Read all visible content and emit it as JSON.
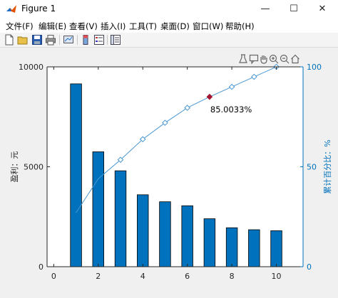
{
  "window": {
    "title": "Figure 1",
    "minimize_glyph": "—",
    "maximize_glyph": "☐",
    "close_glyph": "✕"
  },
  "menu": {
    "items": [
      "文件(F)",
      "编辑(E)",
      "查看(V)",
      "插入(I)",
      "工具(T)",
      "桌面(D)",
      "窗口(W)",
      "帮助(H)"
    ]
  },
  "toolbar": {
    "icons": [
      "new-figure-icon",
      "open-file-icon",
      "save-icon",
      "print-icon",
      "link-plot-icon",
      "insert-colorbar-icon",
      "insert-legend-icon",
      "property-inspector-icon"
    ]
  },
  "axes_toolbar": {
    "icons": [
      "brush-icon",
      "data-tips-icon",
      "pan-icon",
      "zoom-in-icon",
      "zoom-out-icon",
      "home-icon"
    ]
  },
  "chart_data": {
    "type": "bar",
    "x": [
      1,
      2,
      3,
      4,
      5,
      6,
      7,
      8,
      9,
      10
    ],
    "values": [
      9150,
      5750,
      4800,
      3600,
      3250,
      3050,
      2400,
      1950,
      1850,
      1800
    ],
    "cumulative_percent": [
      27.0,
      44.0,
      53.5,
      63.8,
      72.0,
      79.5,
      85.0033,
      90.0,
      95.0,
      100.0
    ],
    "xlim": [
      -0.3,
      11.2
    ],
    "xticks": [
      "0",
      "2",
      "4",
      "6",
      "8",
      "10"
    ],
    "ylabel": "盈利：元",
    "ylim": [
      0,
      10000
    ],
    "yticks": [
      "0",
      "5000",
      "10000"
    ],
    "y2label": "累计百分比：%",
    "y2lim": [
      0,
      100
    ],
    "y2ticks": [
      "0",
      "50",
      "100"
    ],
    "highlight": {
      "x": 7,
      "value": 85.0033,
      "label": "85.0033%"
    },
    "colors": {
      "bar": "#0072bd",
      "line": "#4a97d2",
      "highlight": "#a2142f",
      "right_axis": "#0072bd"
    },
    "grid": false
  }
}
